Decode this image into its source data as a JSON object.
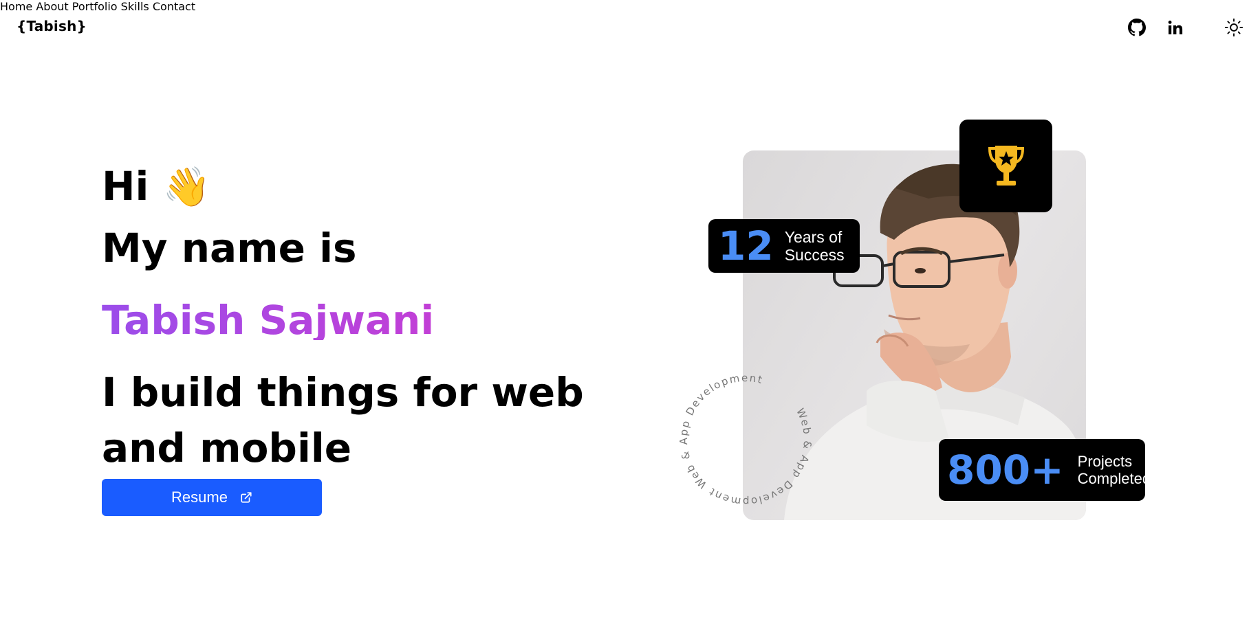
{
  "logo": "{Tabish}",
  "nav": {
    "items": [
      "Home",
      "About",
      "Portfolio",
      "Skills",
      "Contact"
    ],
    "icons": [
      "github-icon",
      "linkedin-icon",
      "sun-icon"
    ]
  },
  "hero": {
    "greeting": "Hi",
    "greeting_emoji": "👋",
    "intro": "My name is",
    "name": "Tabish Sajwani",
    "tagline_line1": "I build things for web",
    "tagline_line2": "and mobile",
    "resume_label": "Resume"
  },
  "stats": {
    "years_value": "12",
    "years_label_line1": "Years of",
    "years_label_line2": "Success",
    "projects_value": "800+",
    "projects_label_line1": "Projects",
    "projects_label_line2": "Completed"
  },
  "circular_text": "Web & App Development Web & App Development",
  "colors": {
    "accent_button": "#1a5cff",
    "name_gradient_start": "#9b4dea",
    "name_gradient_end": "#c23fd6",
    "stat_number": "#4a8df5",
    "trophy": "#f5b820"
  }
}
